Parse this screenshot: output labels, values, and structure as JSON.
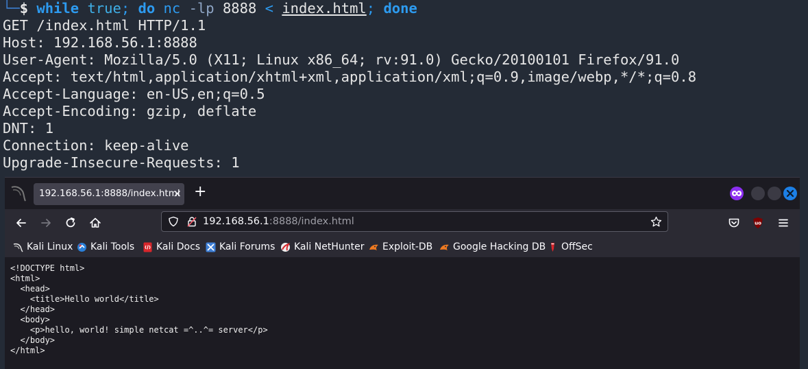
{
  "terminal": {
    "prompt_corner": "└─",
    "prompt_symbol": "$",
    "command": {
      "kw_while": "while",
      "true": "true",
      "semi1": ";",
      "kw_do": "do",
      "nc": "nc",
      "flag": "-lp",
      "port": "8888",
      "redirect": "<",
      "file": "index.html",
      "semi2": ";",
      "kw_done": "done"
    },
    "output": [
      "GET /index.html HTTP/1.1",
      "Host: 192.168.56.1:8888",
      "User-Agent: Mozilla/5.0 (X11; Linux x86_64; rv:91.0) Gecko/20100101 Firefox/91.0",
      "Accept: text/html,application/xhtml+xml,application/xml;q=0.9,image/webp,*/*;q=0.8",
      "Accept-Language: en-US,en;q=0.5",
      "Accept-Encoding: gzip, deflate",
      "DNT: 1",
      "Connection: keep-alive",
      "Upgrade-Insecure-Requests: 1"
    ]
  },
  "browser": {
    "tab": {
      "title": "192.168.56.1:8888/index.html",
      "close": "×"
    },
    "new_tab": "+",
    "url": {
      "host": "192.168.56.1",
      "rest": ":8888/index.html"
    },
    "bookmarks": [
      {
        "label": "Kali Linux",
        "icon": "kali-dragon-icon",
        "color": "#e8e8e8"
      },
      {
        "label": "Kali Tools",
        "icon": "kali-tools-icon",
        "color": "#2a7fd8"
      },
      {
        "label": "Kali Docs",
        "icon": "kali-docs-icon",
        "color": "#d8262b"
      },
      {
        "label": "Kali Forums",
        "icon": "kali-forums-icon",
        "color": "#3e7fd6"
      },
      {
        "label": "Kali NetHunter",
        "icon": "kali-nethunter-icon",
        "color": "#d8262b"
      },
      {
        "label": "Exploit-DB",
        "icon": "exploit-db-icon",
        "color": "#f07a20"
      },
      {
        "label": "Google Hacking DB",
        "icon": "ghdb-icon",
        "color": "#f07a20"
      },
      {
        "label": "OffSec",
        "icon": "offsec-icon",
        "color": "#d8262b"
      }
    ],
    "page_source": [
      "<!DOCTYPE html>",
      "<html>",
      "  <head>",
      "    <title>Hello world</title>",
      "  </head>",
      "  <body>",
      "    <p>hello, world! simple netcat =^..^= server</p>",
      "  </body>",
      "</html>"
    ],
    "colors": {
      "accent": "#1c7fe6",
      "private": "#8c2ff0"
    }
  }
}
